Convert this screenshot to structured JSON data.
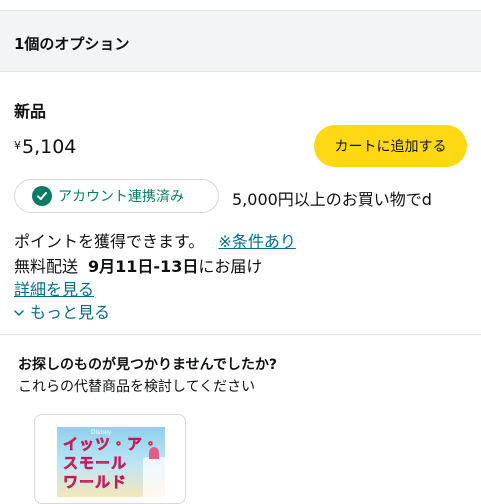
{
  "header": {
    "title": "1個のオプション"
  },
  "offer": {
    "condition": "新品",
    "currency_symbol": "¥",
    "price": "5,104",
    "cart_button_label": "カートに追加する",
    "badge_label": "アカウント連携済み",
    "points_tail": "5,000円以上のお買い物でd",
    "points_line2": "ポイントを獲得できます。",
    "conditions_link": "※条件あり",
    "shipping_label": "無料配送",
    "delivery_date": "9月11日-13日",
    "delivery_suffix": "にお届け",
    "details_link": "詳細を見る",
    "more_link": "もっと見る"
  },
  "alternatives": {
    "title": "お探しのものが見つかりませんでしたか?",
    "subtitle": "これらの代替商品を検討してください",
    "product": {
      "brand_text": "Disney",
      "thumb_lines": [
        "イッツ・ア・",
        "スモール",
        "ワールド"
      ]
    }
  },
  "colors": {
    "cart_button": "#ffd814",
    "link": "#007185",
    "badge_green": "#067d62",
    "header_band": "#f3f4f6"
  }
}
